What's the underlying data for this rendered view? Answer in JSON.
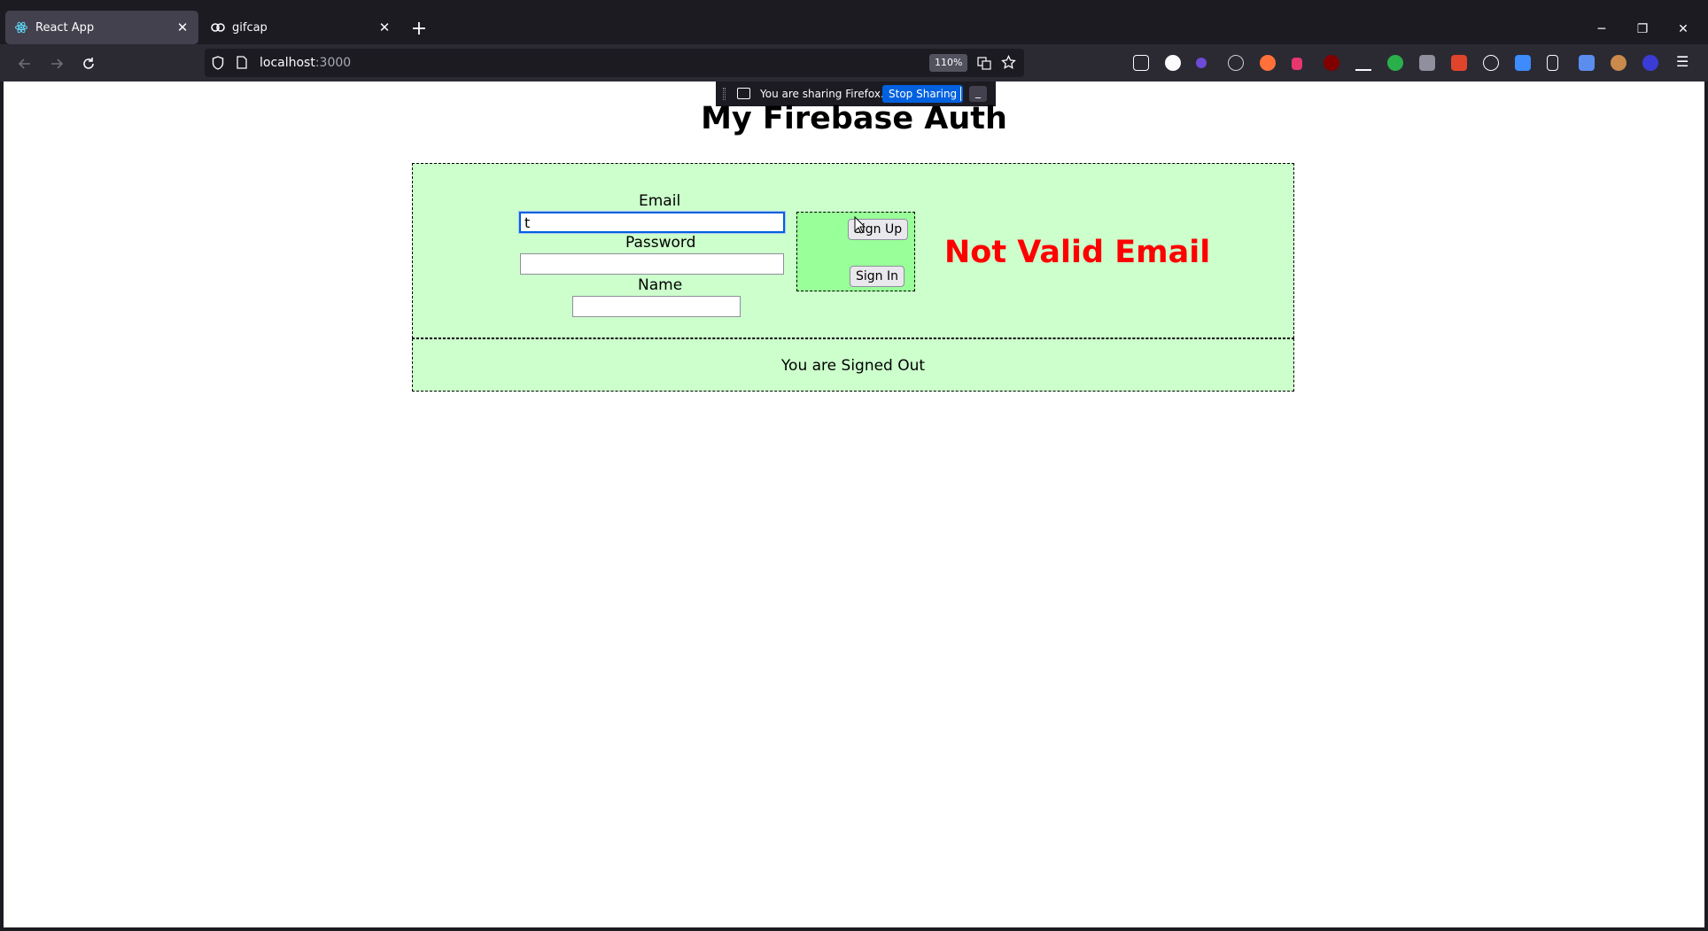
{
  "tabs": [
    {
      "label": "React App",
      "active": true,
      "icon": "react-icon"
    },
    {
      "label": "gifcap",
      "active": false,
      "icon": "gifcap-icon"
    }
  ],
  "newtab_label": "+",
  "address": {
    "host": "localhost",
    "port": ":3000"
  },
  "zoom": "110%",
  "sharing": {
    "text": "You are sharing Firefox.",
    "stop_label": "Stop Sharing",
    "minimize_label": "_"
  },
  "page": {
    "title": "My Firebase Auth",
    "email_label": "Email",
    "email_value": "t",
    "password_label": "Password",
    "password_value": "",
    "name_label": "Name",
    "name_value": "",
    "signup_label": "Sign Up",
    "signin_label": "Sign In",
    "error_message": "Not Valid Email",
    "status": "You are Signed Out"
  },
  "colors": {
    "box_bg": "#ccffcc",
    "button_box_bg": "#99ff99",
    "error": "#ff0000"
  }
}
